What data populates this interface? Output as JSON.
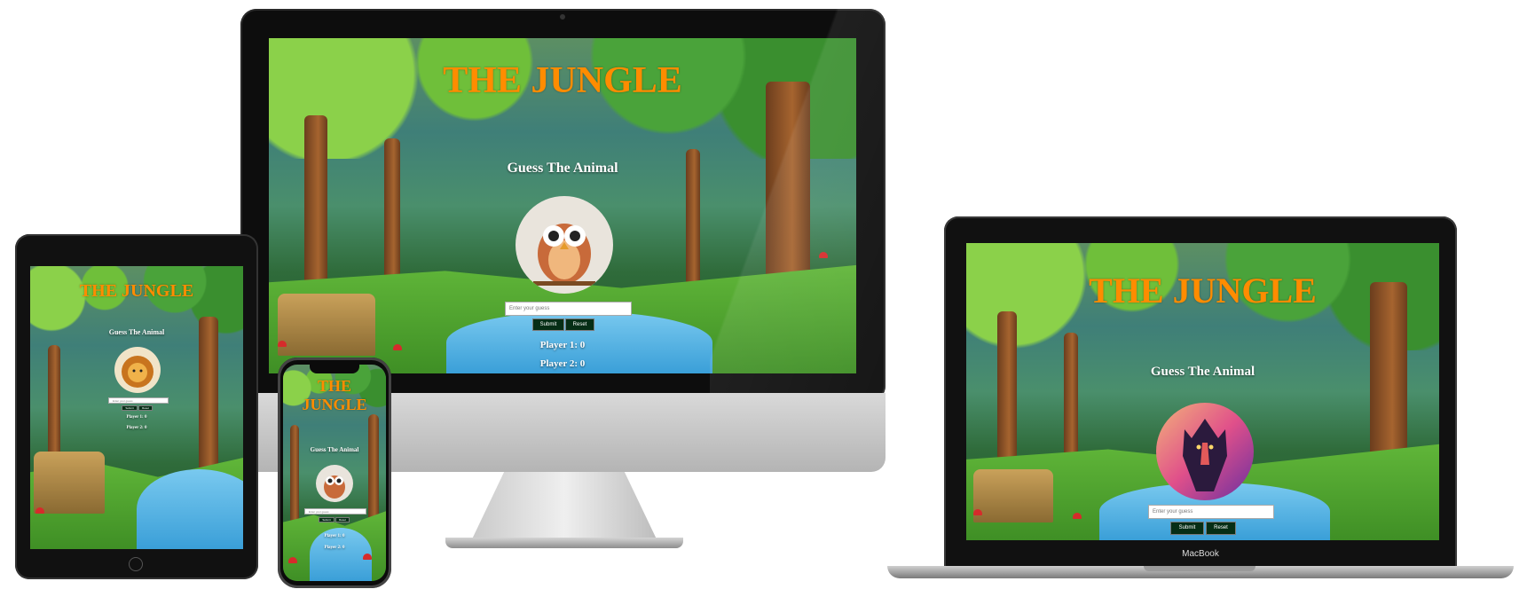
{
  "game": {
    "title": "THE JUNGLE",
    "subtitle": "Guess The Animal",
    "input_placeholder": "Enter your guess",
    "submit_label": "Submit",
    "reset_label": "Reset",
    "player1": "Player 1: 0",
    "player2": "Player 2: 0"
  },
  "devices": {
    "laptop_label": "MacBook"
  },
  "avatars": {
    "imac": "owl",
    "macbook": "wolf",
    "ipad": "lion",
    "iphone": "owl"
  },
  "colors": {
    "title": "#ff8c00",
    "button_bg": "#062e16",
    "text": "#ffffff"
  }
}
